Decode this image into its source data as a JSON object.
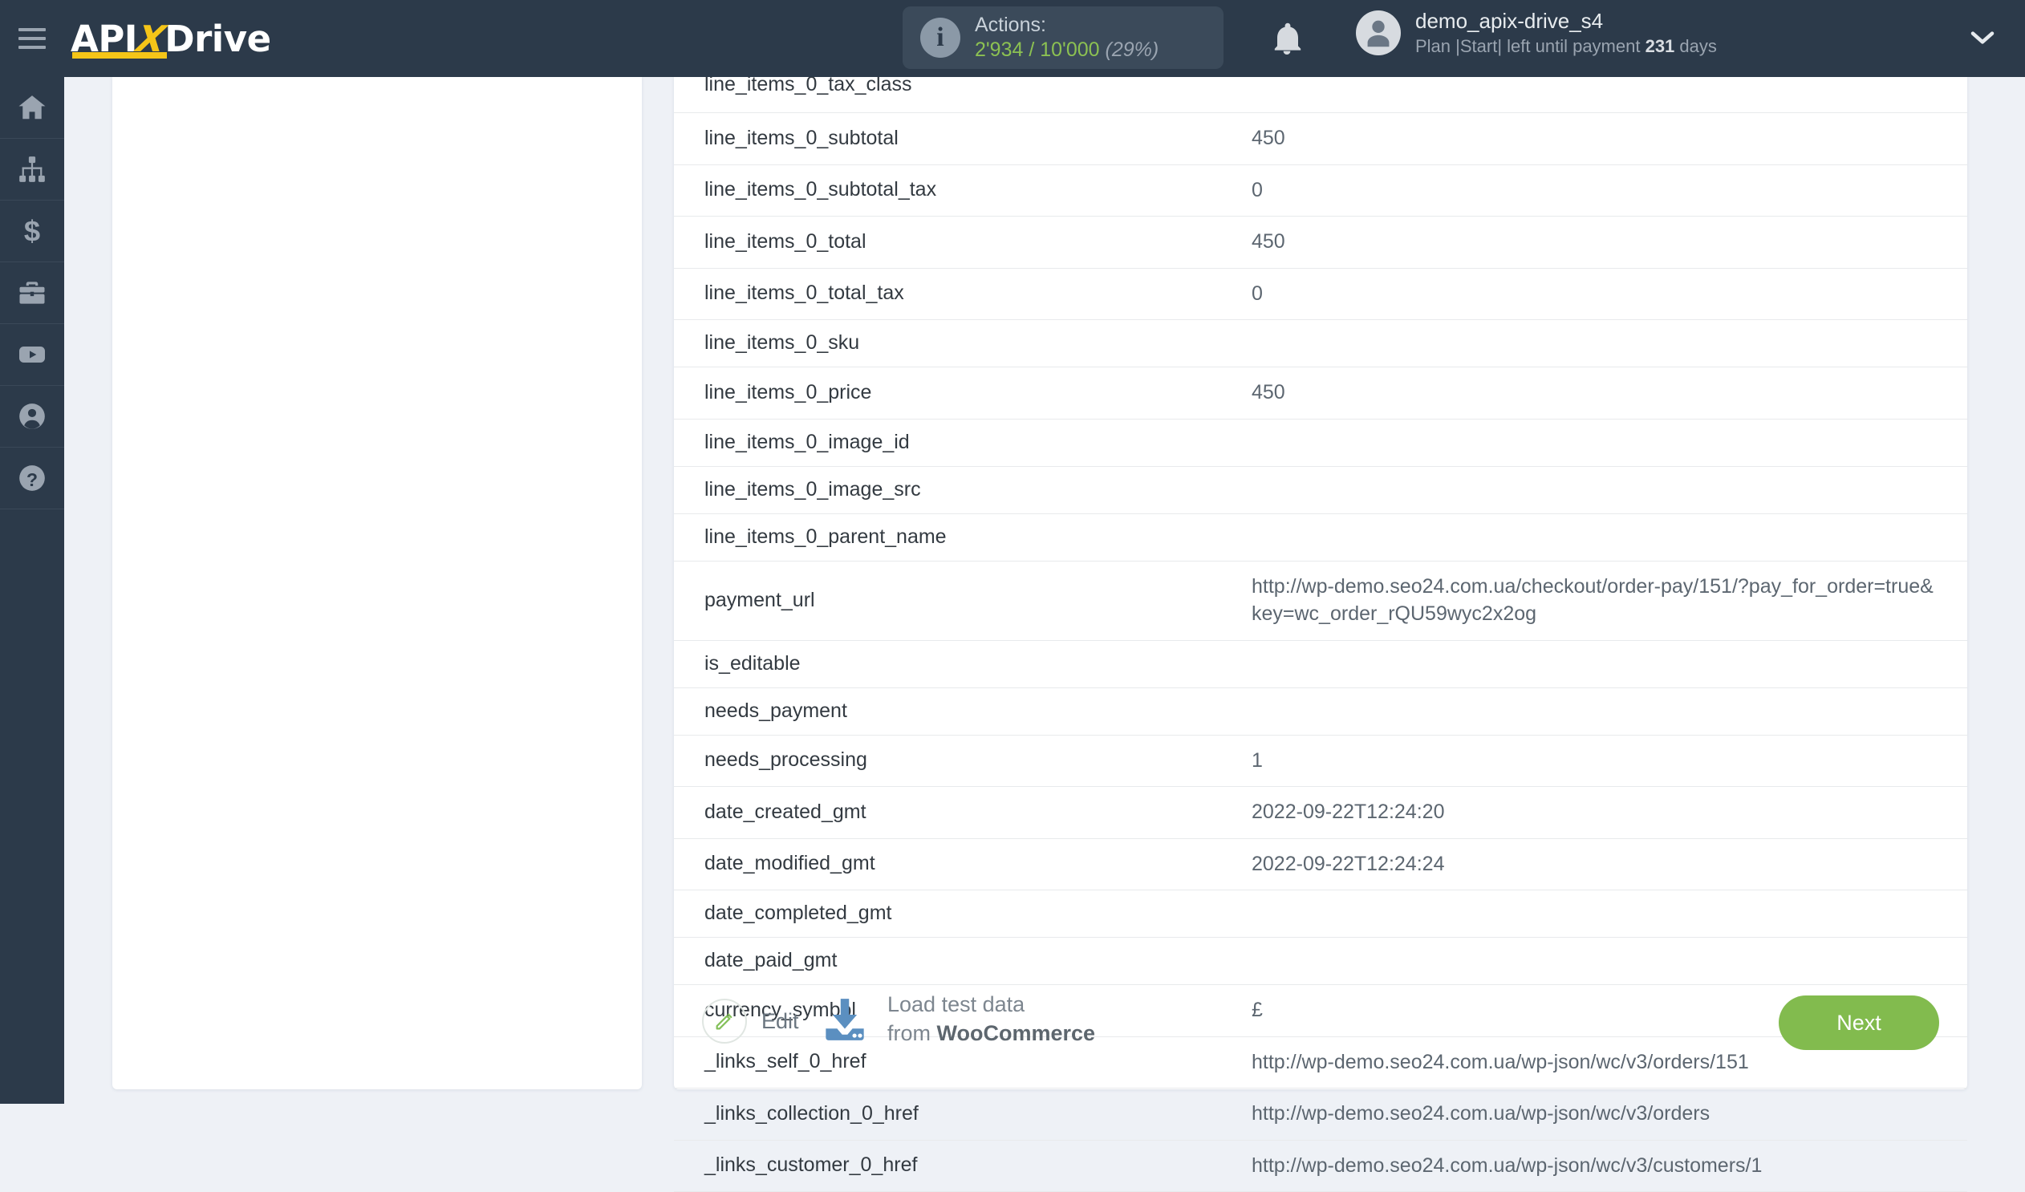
{
  "header": {
    "menu_icon": "hamburger-icon",
    "logo": {
      "part1": "API",
      "x": "X",
      "part2": "Drive"
    },
    "actions": {
      "info_icon": "info-icon",
      "title": "Actions:",
      "used": "2'934",
      "separator": "/",
      "limit": "10'000",
      "percent": "(29%)"
    },
    "bell_icon": "bell-icon",
    "user": {
      "avatar_icon": "user-avatar-icon",
      "name": "demo_apix-drive_s4",
      "plan_prefix": "Plan |Start| left until payment ",
      "plan_days": "231",
      "plan_suffix": " days"
    },
    "chevron_icon": "chevron-down-icon"
  },
  "sidebar": {
    "items": [
      {
        "icon": "home-icon",
        "name": "sidebar-item-home"
      },
      {
        "icon": "sitemap-icon",
        "name": "sidebar-item-connections"
      },
      {
        "icon": "dollar-icon",
        "name": "sidebar-item-billing"
      },
      {
        "icon": "briefcase-icon",
        "name": "sidebar-item-business"
      },
      {
        "icon": "youtube-icon",
        "name": "sidebar-item-video"
      },
      {
        "icon": "user-circle-icon",
        "name": "sidebar-item-account"
      },
      {
        "icon": "question-icon",
        "name": "sidebar-item-help"
      }
    ]
  },
  "table": {
    "rows": [
      {
        "key": "line_items_0_tax_class",
        "value": ""
      },
      {
        "key": "line_items_0_subtotal",
        "value": "450"
      },
      {
        "key": "line_items_0_subtotal_tax",
        "value": "0"
      },
      {
        "key": "line_items_0_total",
        "value": "450"
      },
      {
        "key": "line_items_0_total_tax",
        "value": "0"
      },
      {
        "key": "line_items_0_sku",
        "value": ""
      },
      {
        "key": "line_items_0_price",
        "value": "450"
      },
      {
        "key": "line_items_0_image_id",
        "value": ""
      },
      {
        "key": "line_items_0_image_src",
        "value": ""
      },
      {
        "key": "line_items_0_parent_name",
        "value": ""
      },
      {
        "key": "payment_url",
        "value": "http://wp-demo.seo24.com.ua/checkout/order-pay/151/?pay_for_order=true&key=wc_order_rQU59wyc2x2og"
      },
      {
        "key": "is_editable",
        "value": ""
      },
      {
        "key": "needs_payment",
        "value": ""
      },
      {
        "key": "needs_processing",
        "value": "1"
      },
      {
        "key": "date_created_gmt",
        "value": "2022-09-22T12:24:20"
      },
      {
        "key": "date_modified_gmt",
        "value": "2022-09-22T12:24:24"
      },
      {
        "key": "date_completed_gmt",
        "value": ""
      },
      {
        "key": "date_paid_gmt",
        "value": ""
      },
      {
        "key": "currency_symbol",
        "value": "£"
      },
      {
        "key": "_links_self_0_href",
        "value": "http://wp-demo.seo24.com.ua/wp-json/wc/v3/orders/151"
      },
      {
        "key": "_links_collection_0_href",
        "value": "http://wp-demo.seo24.com.ua/wp-json/wc/v3/orders"
      },
      {
        "key": "_links_customer_0_href",
        "value": "http://wp-demo.seo24.com.ua/wp-json/wc/v3/customers/1"
      }
    ]
  },
  "footer": {
    "edit_icon": "pencil-icon",
    "edit_label": "Edit",
    "download_icon": "download-icon",
    "load_line1": "Load test data",
    "load_line2_prefix": "from ",
    "load_line2_service": "WooCommerce",
    "next_label": "Next"
  },
  "colors": {
    "header_bg": "#2c3a4a",
    "accent_yellow": "#f5c518",
    "accent_green": "#82bb4e",
    "counter_green": "#8cc152",
    "download_blue": "#5b8fc0",
    "page_bg": "#eef1f6"
  }
}
